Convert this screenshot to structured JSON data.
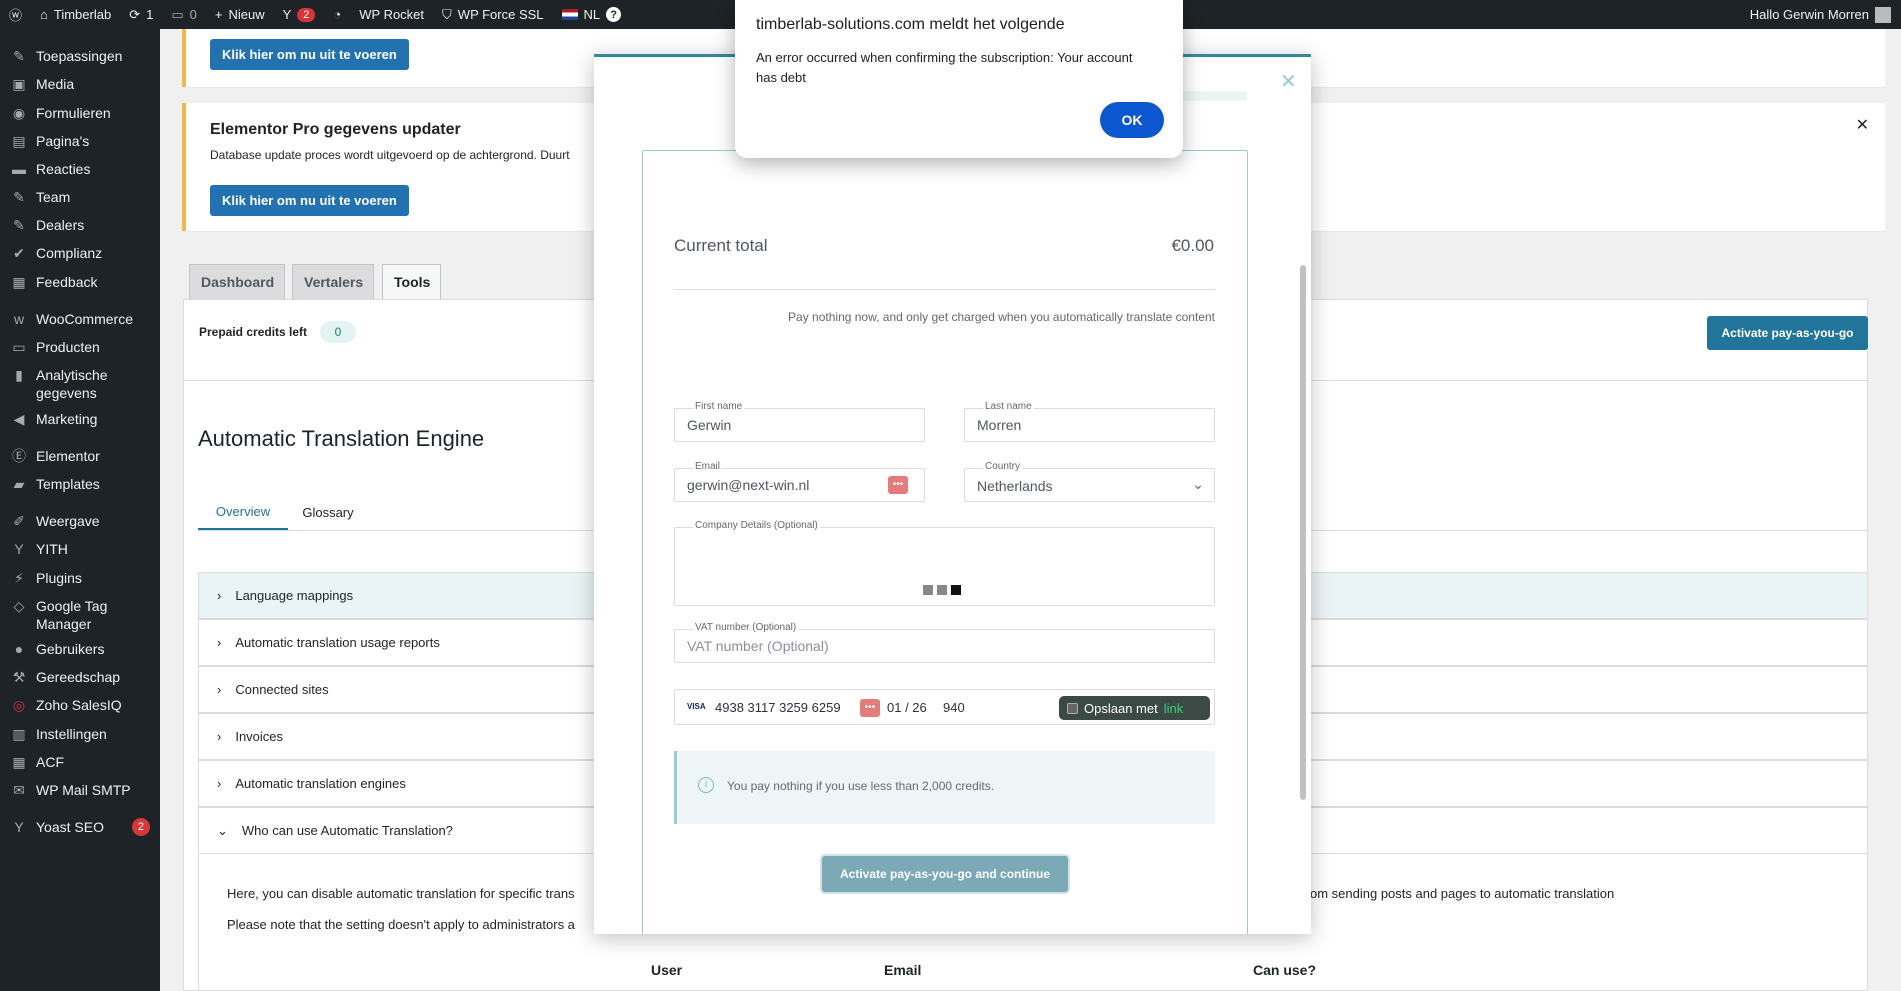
{
  "adminbar": {
    "site_name": "Timberlab",
    "updates": "1",
    "comments": "0",
    "new_label": "Nieuw",
    "yoast_badge": "2",
    "rocket": "WP Rocket",
    "force_ssl": "WP Force SSL",
    "lang": "NL",
    "greeting": "Hallo Gerwin Morren"
  },
  "sidebar": {
    "items": [
      {
        "label": "Toepassingen",
        "icon": "pin-icon"
      },
      {
        "label": "Media",
        "icon": "media-icon"
      },
      {
        "label": "Formulieren",
        "icon": "forms-icon"
      },
      {
        "label": "Pagina's",
        "icon": "page-icon"
      },
      {
        "label": "Reacties",
        "icon": "comment-icon"
      },
      {
        "label": "Team",
        "icon": "pin-icon"
      },
      {
        "label": "Dealers",
        "icon": "pin-icon"
      },
      {
        "label": "Complianz",
        "icon": "check-icon"
      },
      {
        "label": "Feedback",
        "icon": "feedback-icon"
      },
      {
        "label": "WooCommerce",
        "icon": "woo-icon"
      },
      {
        "label": "Producten",
        "icon": "archive-icon"
      },
      {
        "label": "Analytische gegevens",
        "icon": "chart-icon"
      },
      {
        "label": "Marketing",
        "icon": "megaphone-icon"
      },
      {
        "label": "Elementor",
        "icon": "elementor-icon"
      },
      {
        "label": "Templates",
        "icon": "folder-icon"
      },
      {
        "label": "Weergave",
        "icon": "brush-icon"
      },
      {
        "label": "YITH",
        "icon": "yith-icon"
      },
      {
        "label": "Plugins",
        "icon": "plugin-icon"
      },
      {
        "label": "Google Tag Manager",
        "icon": "tag-icon"
      },
      {
        "label": "Gebruikers",
        "icon": "users-icon"
      },
      {
        "label": "Gereedschap",
        "icon": "wrench-icon"
      },
      {
        "label": "Zoho SalesIQ",
        "icon": "zoho-icon"
      },
      {
        "label": "Instellingen",
        "icon": "settings-icon"
      },
      {
        "label": "ACF",
        "icon": "acf-icon"
      },
      {
        "label": "WP Mail SMTP",
        "icon": "mail-icon"
      },
      {
        "label": "Yoast SEO",
        "icon": "yoast-icon",
        "badge": "2"
      }
    ]
  },
  "notice1": {
    "button": "Klik hier om nu uit te voeren"
  },
  "notice2": {
    "title": "Elementor Pro gegevens updater",
    "text": "Database update proces wordt uitgevoerd op de achtergrond. Duurt",
    "button": "Klik hier om nu uit te voeren"
  },
  "tabs": [
    "Dashboard",
    "Vertalers",
    "Tools"
  ],
  "credits": {
    "label": "Prepaid credits left",
    "value": "0",
    "activate": "Activate pay-as-you-go"
  },
  "engine": {
    "title": "Automatic Translation Engine",
    "subtabs": [
      "Overview",
      "Glossary"
    ],
    "rows": [
      "Language mappings",
      "Automatic translation usage reports",
      "Connected sites",
      "Invoices",
      "Automatic translation engines",
      "Who can use Automatic Translation?"
    ],
    "para1": "Here, you can disable automatic translation for specific trans",
    "para1_right": "om sending posts and pages to automatic translation",
    "para2": "Please note that the setting doesn't apply to administrators a",
    "table_headers": [
      "User",
      "Email",
      "Can use?"
    ]
  },
  "modal": {
    "total_label": "Current total",
    "total_value": "€0.00",
    "note": "Pay nothing now, and only get charged when you automatically translate content",
    "first_name_label": "First name",
    "first_name": "Gerwin",
    "last_name_label": "Last name",
    "last_name": "Morren",
    "email_label": "Email",
    "email": "gerwin@next-win.nl",
    "country_label": "Country",
    "country": "Netherlands",
    "company_label": "Company Details (Optional)",
    "vat_label": "VAT number (Optional)",
    "vat_placeholder": "VAT number (Optional)",
    "card_brand": "VISA",
    "card_number": "4938 3117 3259 6259",
    "card_exp": "01 / 26",
    "card_cvc": "940",
    "save_with": "Opslaan met",
    "link_word": "link",
    "info": "You pay nothing if you use less than 2,000 credits.",
    "submit": "Activate pay-as-you-go and continue"
  },
  "dialog": {
    "title": "timberlab-solutions.com meldt het volgende",
    "message": "An error occurred when confirming the subscription: Your account has debt",
    "ok": "OK"
  },
  "colors": {
    "accent": "#21759b",
    "wp_dark": "#1d2327",
    "wp_blue": "#2271b1",
    "dialog_blue": "#0b57d0"
  }
}
